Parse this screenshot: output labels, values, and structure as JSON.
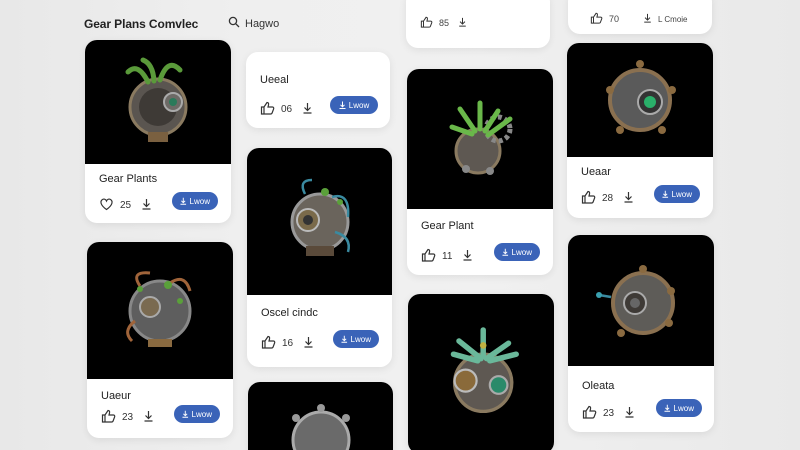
{
  "header": {
    "title": "Gear Plans Comvlec",
    "search_text": "Hagwo"
  },
  "cards": [
    {
      "title": "Gear Plants",
      "likes": "25",
      "button": "Lwow"
    },
    {
      "title": "Ueeal",
      "likes": "06",
      "button": "Lwow"
    },
    {
      "title": "Oscel cindc",
      "likes": "16",
      "button": "Lwow"
    },
    {
      "title": "",
      "likes": "85",
      "button": ""
    },
    {
      "title": "Gear Plant",
      "likes": "11",
      "button": "Lwow"
    },
    {
      "title": "",
      "likes": "70",
      "button": "L Cmoie"
    },
    {
      "title": "Ueaar",
      "likes": "28",
      "button": "Lwow"
    },
    {
      "title": "Uaeur",
      "likes": "23",
      "button": "Lwow"
    },
    {
      "title": "Oleata",
      "likes": "23",
      "button": "Lwow"
    }
  ],
  "colors": {
    "accent": "#3a63b8",
    "image_bg": "#000000"
  },
  "icons": [
    "search-icon",
    "heart-icon",
    "thumbs-up-icon",
    "download-icon"
  ]
}
